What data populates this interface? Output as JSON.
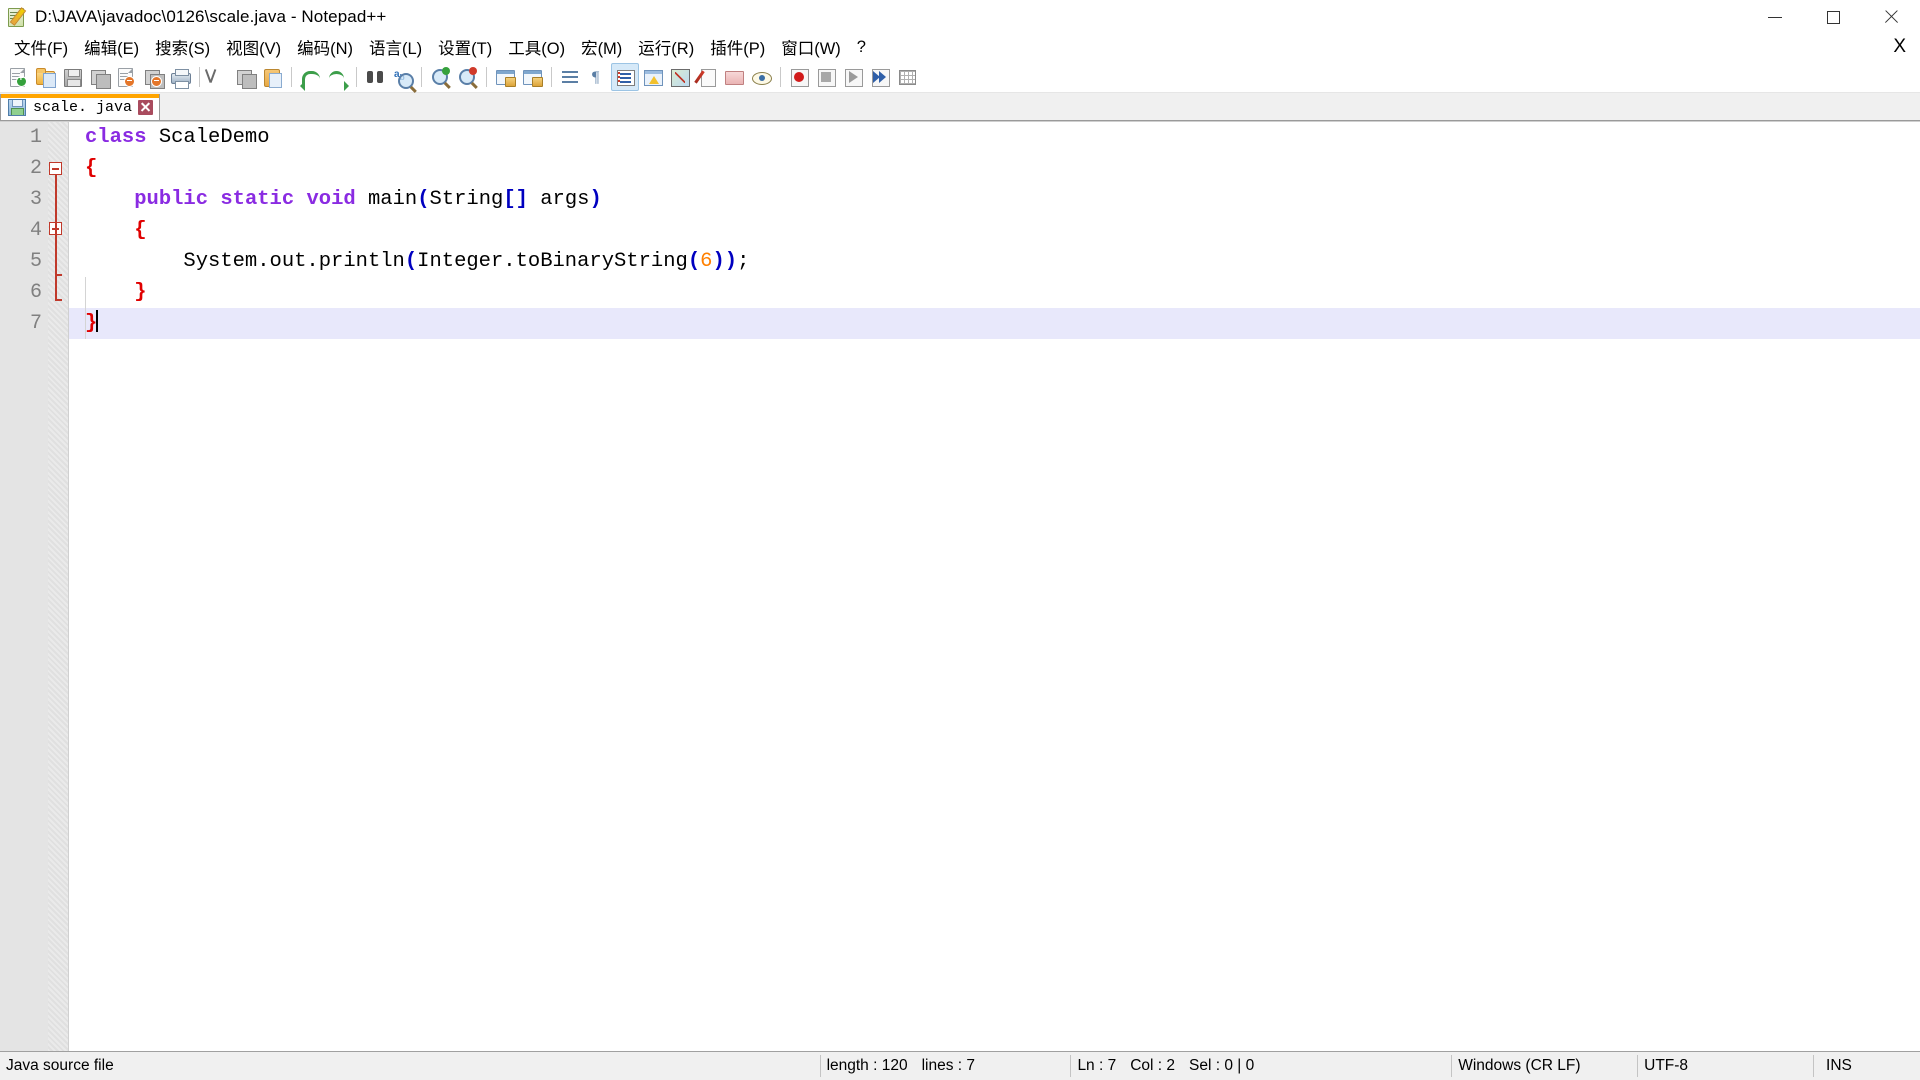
{
  "window": {
    "title": "D:\\JAVA\\javadoc\\0126\\scale.java - Notepad++",
    "icon": "notepadpp-icon",
    "controls": {
      "minimize": "minimize-icon",
      "maximize": "restore-icon",
      "close": "close-icon"
    }
  },
  "menubar": {
    "items": [
      {
        "label": "文件(F)",
        "name": "menu-file"
      },
      {
        "label": "编辑(E)",
        "name": "menu-edit"
      },
      {
        "label": "搜索(S)",
        "name": "menu-search"
      },
      {
        "label": "视图(V)",
        "name": "menu-view"
      },
      {
        "label": "编码(N)",
        "name": "menu-encoding"
      },
      {
        "label": "语言(L)",
        "name": "menu-language"
      },
      {
        "label": "设置(T)",
        "name": "menu-settings"
      },
      {
        "label": "工具(O)",
        "name": "menu-tools"
      },
      {
        "label": "宏(M)",
        "name": "menu-macro"
      },
      {
        "label": "运行(R)",
        "name": "menu-run"
      },
      {
        "label": "插件(P)",
        "name": "menu-plugins"
      },
      {
        "label": "窗口(W)",
        "name": "menu-window"
      },
      {
        "label": "?",
        "name": "menu-help"
      }
    ],
    "close_document": "X"
  },
  "toolbar": {
    "buttons": [
      {
        "name": "new-file-icon",
        "title": "新建"
      },
      {
        "name": "open-file-icon",
        "title": "打开"
      },
      {
        "name": "save-icon",
        "title": "保存"
      },
      {
        "name": "save-all-icon",
        "title": "保存全部"
      },
      {
        "name": "close-file-icon",
        "title": "关闭"
      },
      {
        "name": "close-all-files-icon",
        "title": "关闭全部"
      },
      {
        "name": "print-icon",
        "title": "打印"
      },
      {
        "name": "cut-icon",
        "title": "剪切"
      },
      {
        "name": "copy-icon",
        "title": "复制"
      },
      {
        "name": "paste-icon",
        "title": "粘贴"
      },
      {
        "name": "undo-icon",
        "title": "撤销"
      },
      {
        "name": "redo-icon",
        "title": "重做"
      },
      {
        "name": "find-icon",
        "title": "查找"
      },
      {
        "name": "replace-icon",
        "title": "替换"
      },
      {
        "name": "zoom-in-icon",
        "title": "放大"
      },
      {
        "name": "zoom-out-icon",
        "title": "缩小"
      },
      {
        "name": "sync-vertical-scroll-icon",
        "title": "同步垂直滚动"
      },
      {
        "name": "sync-horizontal-scroll-icon",
        "title": "同步水平滚动"
      },
      {
        "name": "word-wrap-icon",
        "title": "自动换行"
      },
      {
        "name": "show-all-characters-icon",
        "title": "显示所有字符"
      },
      {
        "name": "show-indent-guide-icon",
        "title": "显示缩进参考线",
        "active": true
      },
      {
        "name": "user-defined-dialog-icon",
        "title": "用户自定义"
      },
      {
        "name": "document-map-icon",
        "title": "文档地图"
      },
      {
        "name": "function-list-icon",
        "title": "函数列表"
      },
      {
        "name": "folder-as-workspace-icon",
        "title": "文件夹工作区"
      },
      {
        "name": "monitoring-icon",
        "title": "监视文件"
      },
      {
        "name": "macro-record-icon",
        "title": "录制宏"
      },
      {
        "name": "macro-stop-icon",
        "title": "停止录制"
      },
      {
        "name": "macro-play-icon",
        "title": "播放宏"
      },
      {
        "name": "macro-run-multiple-icon",
        "title": "多次运行宏"
      },
      {
        "name": "macro-save-icon",
        "title": "保存当前录制的宏"
      }
    ]
  },
  "tabs": [
    {
      "label": "scale. java",
      "icon": "saved-file-icon",
      "close": "close-tab-icon",
      "active": true
    }
  ],
  "editor": {
    "line_numbers": [
      "1",
      "2",
      "3",
      "4",
      "5",
      "6",
      "7"
    ],
    "current_line": 7,
    "lines": [
      {
        "n": 1,
        "tokens": [
          {
            "t": "class",
            "c": "kw"
          },
          {
            "t": " ScaleDemo",
            "c": "plain"
          }
        ]
      },
      {
        "n": 2,
        "tokens": [
          {
            "t": "{",
            "c": "brace"
          }
        ]
      },
      {
        "n": 3,
        "tokens": [
          {
            "t": "    ",
            "c": "plain"
          },
          {
            "t": "public",
            "c": "kw"
          },
          {
            "t": " ",
            "c": "plain"
          },
          {
            "t": "static",
            "c": "kw"
          },
          {
            "t": " ",
            "c": "plain"
          },
          {
            "t": "void",
            "c": "kw"
          },
          {
            "t": " main",
            "c": "plain"
          },
          {
            "t": "(",
            "c": "paren"
          },
          {
            "t": "String",
            "c": "plain"
          },
          {
            "t": "[]",
            "c": "paren"
          },
          {
            "t": " args",
            "c": "plain"
          },
          {
            "t": ")",
            "c": "paren"
          }
        ]
      },
      {
        "n": 4,
        "tokens": [
          {
            "t": "    ",
            "c": "plain"
          },
          {
            "t": "{",
            "c": "brace"
          }
        ]
      },
      {
        "n": 5,
        "tokens": [
          {
            "t": "        System.out.println",
            "c": "plain"
          },
          {
            "t": "(",
            "c": "paren"
          },
          {
            "t": "Integer.toBinaryString",
            "c": "plain"
          },
          {
            "t": "(",
            "c": "paren"
          },
          {
            "t": "6",
            "c": "num"
          },
          {
            "t": "))",
            "c": "paren"
          },
          {
            "t": ";",
            "c": "plain"
          }
        ]
      },
      {
        "n": 6,
        "tokens": [
          {
            "t": "    ",
            "c": "plain"
          },
          {
            "t": "}",
            "c": "brace"
          }
        ]
      },
      {
        "n": 7,
        "tokens": [
          {
            "t": "}",
            "c": "brace"
          }
        ]
      }
    ]
  },
  "statusbar": {
    "doc_type": "Java source file",
    "length_label": "length : 120",
    "lines_label": "lines : 7",
    "ln": "Ln : 7",
    "col": "Col : 2",
    "sel": "Sel : 0 | 0",
    "eol": "Windows (CR LF)",
    "encoding": "UTF-8",
    "insert_mode": "INS"
  },
  "colors": {
    "keyword": "#8a2be2",
    "brace": "#e00000",
    "paren": "#0000c0",
    "number": "#ff8000",
    "tab_accent": "#ffa500",
    "current_line": "#e8e8fb",
    "gutter": "#e4e4e4"
  }
}
